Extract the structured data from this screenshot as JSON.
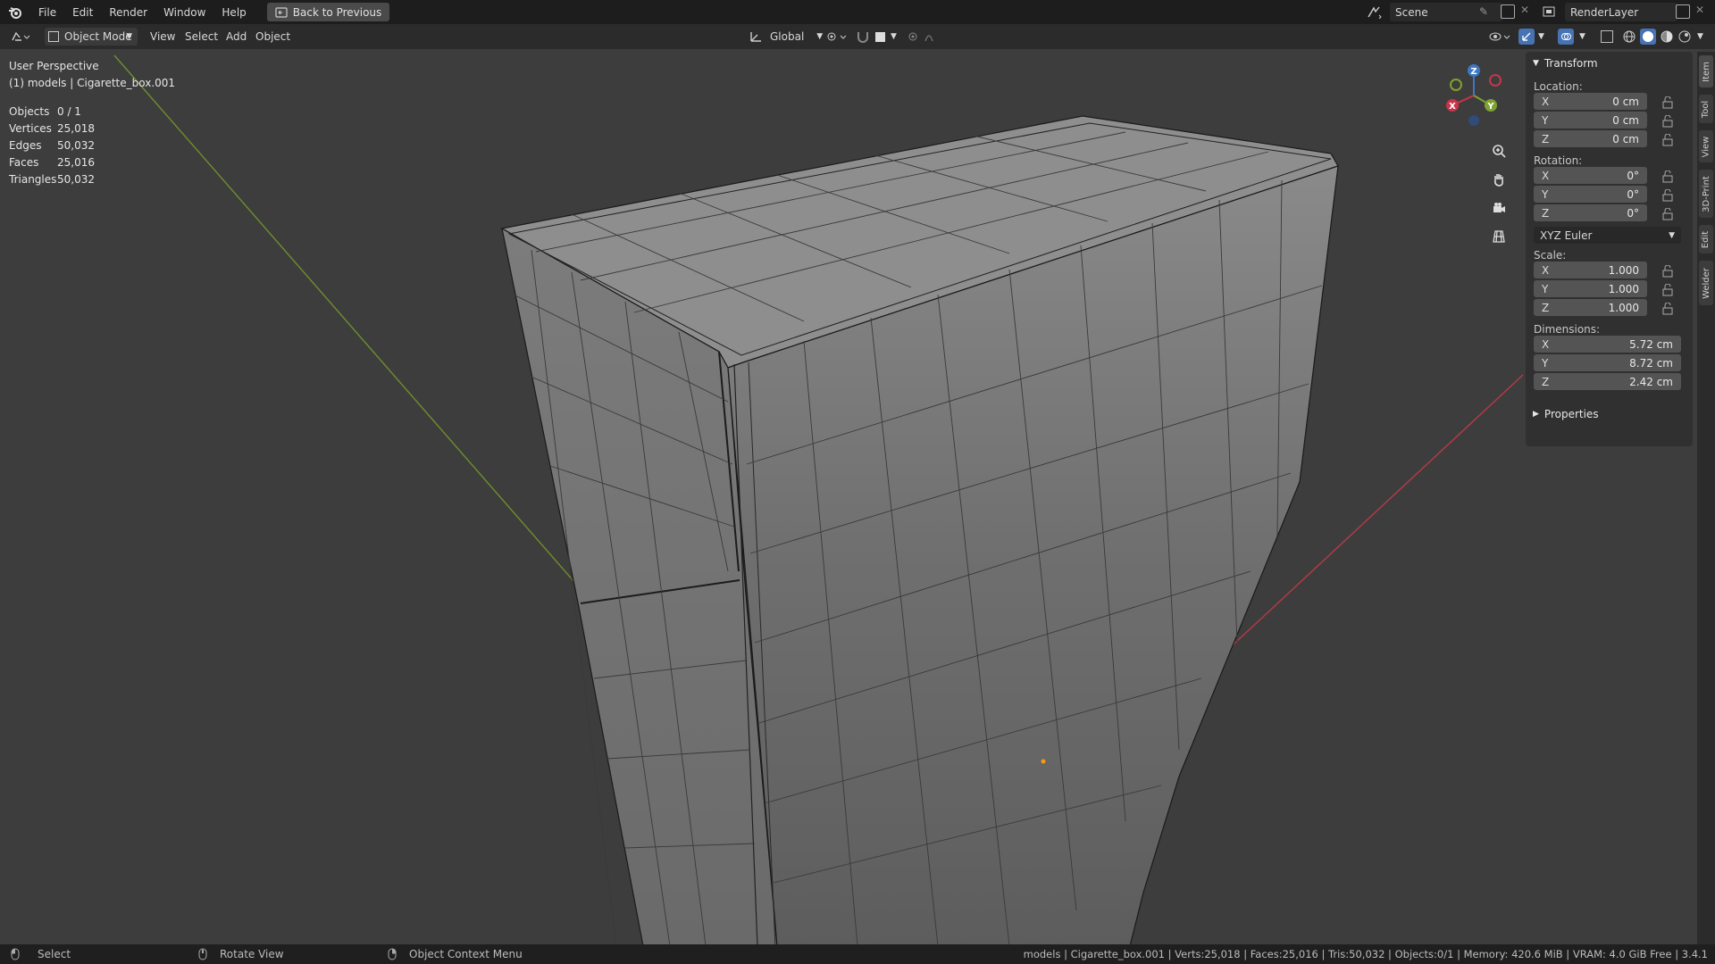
{
  "menu": {
    "items": [
      "File",
      "Edit",
      "Render",
      "Window",
      "Help"
    ],
    "back_button": "Back to Previous"
  },
  "scene": {
    "name": "Scene",
    "render_layer": "RenderLayer"
  },
  "header": {
    "mode": "Object Mode",
    "menus": [
      "View",
      "Select",
      "Add",
      "Object"
    ],
    "orientation": "Global"
  },
  "viewport": {
    "perspective": "User Perspective",
    "object_info": "(1) models | Cigarette_box.001",
    "stats": [
      {
        "label": "Objects",
        "value": "0 / 1"
      },
      {
        "label": "Vertices",
        "value": "25,018"
      },
      {
        "label": "Edges",
        "value": "50,032"
      },
      {
        "label": "Faces",
        "value": "25,016"
      },
      {
        "label": "Triangles",
        "value": "50,032"
      }
    ]
  },
  "gizmo": {
    "x": "X",
    "y": "Y",
    "z": "Z"
  },
  "npanel": {
    "title": "Transform",
    "location_label": "Location:",
    "location": [
      {
        "axis": "X",
        "value": "0 cm"
      },
      {
        "axis": "Y",
        "value": "0 cm"
      },
      {
        "axis": "Z",
        "value": "0 cm"
      }
    ],
    "rotation_label": "Rotation:",
    "rotation": [
      {
        "axis": "X",
        "value": "0°"
      },
      {
        "axis": "Y",
        "value": "0°"
      },
      {
        "axis": "Z",
        "value": "0°"
      }
    ],
    "rotation_mode": "XYZ Euler",
    "scale_label": "Scale:",
    "scale": [
      {
        "axis": "X",
        "value": "1.000"
      },
      {
        "axis": "Y",
        "value": "1.000"
      },
      {
        "axis": "Z",
        "value": "1.000"
      }
    ],
    "dimensions_label": "Dimensions:",
    "dimensions": [
      {
        "axis": "X",
        "value": "5.72 cm"
      },
      {
        "axis": "Y",
        "value": "8.72 cm"
      },
      {
        "axis": "Z",
        "value": "2.42 cm"
      }
    ],
    "properties_label": "Properties"
  },
  "sidetabs": [
    "Item",
    "Tool",
    "View",
    "3D-Print",
    "Edit",
    "Welder"
  ],
  "statusbar": {
    "select": "Select",
    "rotate": "Rotate View",
    "context": "Object Context Menu",
    "info": "models | Cigarette_box.001 | Verts:25,018 | Faces:25,016 | Tris:50,032 | Objects:0/1 | Memory: 420.6 MiB | VRAM: 4.0 GiB Free | 3.4.1"
  },
  "colors": {
    "accent": "#4772b3",
    "x_axis": "#c8354a",
    "y_axis": "#7ea230",
    "z_axis": "#3e78c4",
    "origin": "#f09a20"
  }
}
